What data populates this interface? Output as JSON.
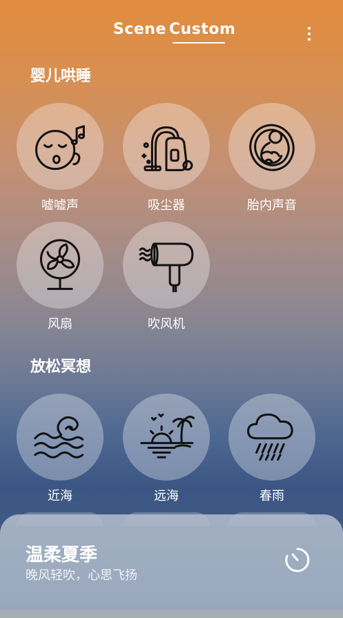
{
  "tabs": {
    "scene": "Scene",
    "custom": "Custom",
    "active": "custom"
  },
  "sections": [
    {
      "title": "婴儿哄睡",
      "items": [
        {
          "label": "嘘嘘声",
          "icon": "sleeping-face-icon"
        },
        {
          "label": "吸尘器",
          "icon": "vacuum-cleaner-icon"
        },
        {
          "label": "胎内声音",
          "icon": "fetus-icon"
        },
        {
          "label": "风扇",
          "icon": "fan-icon"
        },
        {
          "label": "吹风机",
          "icon": "hair-dryer-icon"
        }
      ]
    },
    {
      "title": "放松冥想",
      "items": [
        {
          "label": "近海",
          "icon": "waves-icon"
        },
        {
          "label": "远海",
          "icon": "sunset-beach-icon"
        },
        {
          "label": "春雨",
          "icon": "rain-cloud-icon"
        }
      ]
    }
  ],
  "player": {
    "title": "温柔夏季",
    "subtitle": "晚风轻吹，心思飞扬",
    "icon": "timer-icon"
  }
}
